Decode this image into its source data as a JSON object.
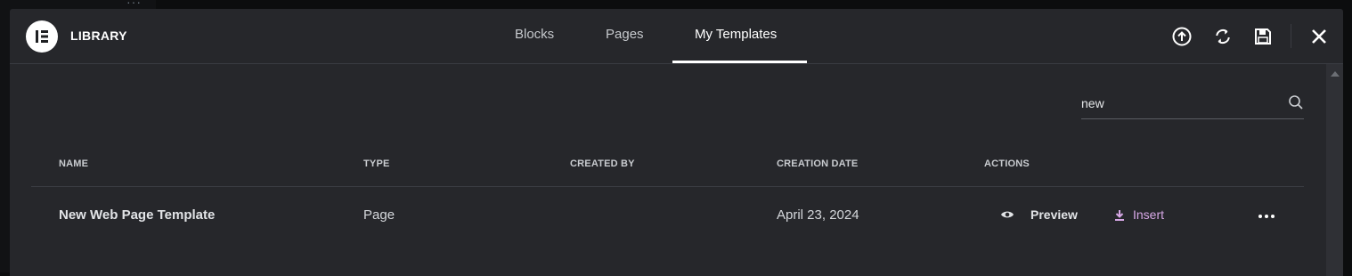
{
  "modal": {
    "title": "LIBRARY",
    "tabs": [
      {
        "label": "Blocks",
        "active": false
      },
      {
        "label": "Pages",
        "active": false
      },
      {
        "label": "My Templates",
        "active": true
      }
    ],
    "header_icons": [
      "upload-icon",
      "sync-icon",
      "save-icon",
      "close-icon"
    ]
  },
  "search": {
    "value": "new",
    "placeholder": ""
  },
  "table": {
    "columns": [
      "NAME",
      "TYPE",
      "CREATED BY",
      "CREATION DATE",
      "ACTIONS"
    ],
    "rows": [
      {
        "name": "New Web Page Template",
        "type": "Page",
        "created_by": "",
        "creation_date": "April 23, 2024",
        "actions": {
          "preview": "Preview",
          "insert": "Insert"
        }
      }
    ]
  },
  "colors": {
    "accent_insert": "#d7a8e6",
    "modal_bg": "#26272b"
  }
}
